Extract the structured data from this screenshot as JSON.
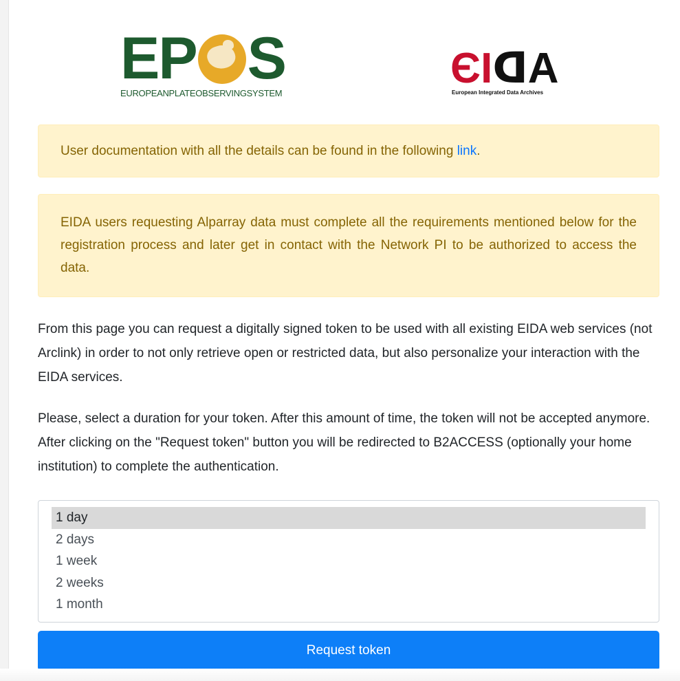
{
  "logos": {
    "epos": {
      "letters_left": "EP",
      "letters_right": "S",
      "tagline": "EUROPEANPLATEOBSERVINGSYSTEM",
      "colors": {
        "green": "#1d5a2e",
        "globe": "#e7a928"
      }
    },
    "eida": {
      "letters_red": "ЄI",
      "letters_black": "ᗡA",
      "tagline": "European Integrated Data Archives",
      "colors": {
        "red": "#c8102e",
        "black": "#111111"
      }
    }
  },
  "alerts": {
    "documentation": {
      "text_before": "User documentation with all the details can be found in the following ",
      "link_text": "link",
      "text_after": "."
    },
    "alparray": "EIDA users requesting Alparray data must complete all the requirements mentioned below for the registration process and later get in contact with the Network PI to be authorized to access the data."
  },
  "paragraphs": {
    "intro": "From this page you can request a digitally signed token to be used with all existing EIDA web services (not Arclink) in order to not only retrieve open or restricted data, but also personalize your interaction with the EIDA services.",
    "duration": "Please, select a duration for your token. After this amount of time, the token will not be accepted anymore. After clicking on the \"Request token\" button you will be redirected to B2ACCESS (optionally your home institution) to complete the authentication."
  },
  "duration_select": {
    "options": [
      "1 day",
      "2 days",
      "1 week",
      "2 weeks",
      "1 month"
    ],
    "selected": "1 day"
  },
  "request_button": {
    "label": "Request token",
    "color": "#0d7ff8"
  },
  "theme": {
    "alert_bg": "#fff3cd",
    "alert_text": "#856404",
    "link": "#0a75ff"
  }
}
